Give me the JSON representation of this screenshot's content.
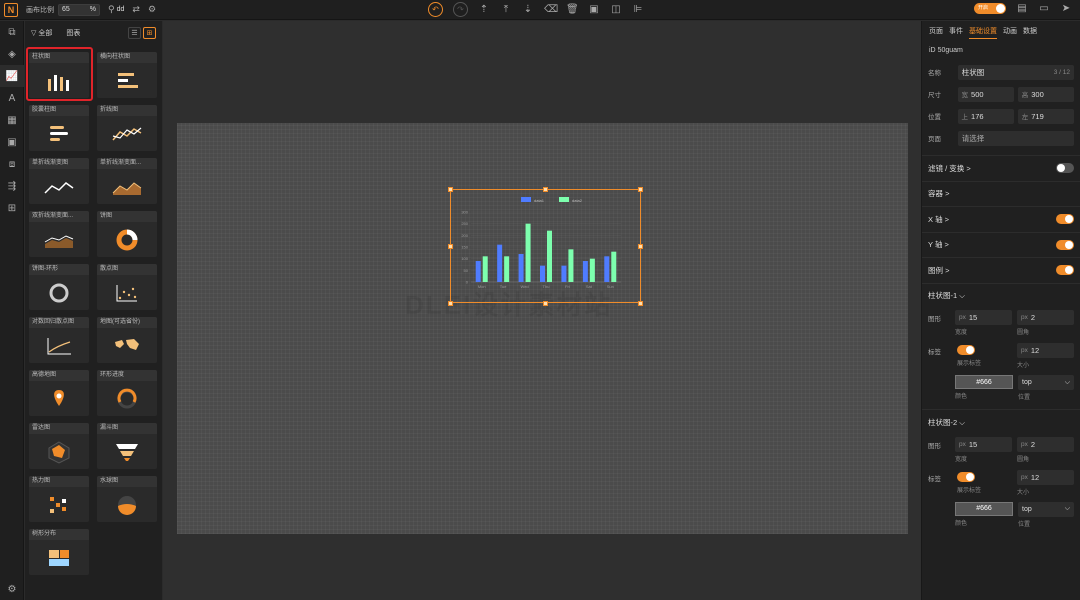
{
  "toolbar": {
    "zoom_label": "画布比例",
    "zoom_value": "65",
    "zoom_unit": "%",
    "user_text": "dd",
    "toggle_text": "开启"
  },
  "left_panel": {
    "filter_label": "全部",
    "title": "图表",
    "items": [
      {
        "label": "柱状图"
      },
      {
        "label": "横向柱状图"
      },
      {
        "label": "胶囊柱图"
      },
      {
        "label": "折线图"
      },
      {
        "label": "单折线渐变图"
      },
      {
        "label": "单折线渐变面..."
      },
      {
        "label": "双折线渐变面..."
      },
      {
        "label": "饼图"
      },
      {
        "label": "饼图-环形"
      },
      {
        "label": "散点图"
      },
      {
        "label": "对数回归散点图"
      },
      {
        "label": "地图(可选省份)"
      },
      {
        "label": "高德地图"
      },
      {
        "label": "环形进度"
      },
      {
        "label": "雷达图"
      },
      {
        "label": "漏斗图"
      },
      {
        "label": "热力图"
      },
      {
        "label": "水球图"
      },
      {
        "label": "树形分布"
      }
    ]
  },
  "mini_chart": {
    "legend": [
      "data1",
      "data2"
    ],
    "categories": [
      "Mon",
      "Tue",
      "Wed",
      "Thu",
      "Fri",
      "Sat",
      "Sun"
    ],
    "series1": [
      90,
      160,
      120,
      70,
      70,
      90,
      110
    ],
    "series2": [
      110,
      110,
      250,
      220,
      140,
      100,
      130
    ],
    "yticks": [
      "300",
      "250",
      "200",
      "150",
      "100",
      "50",
      "0"
    ],
    "colors": [
      "#4f7cff",
      "#7dffae"
    ]
  },
  "canvas": {
    "watermark": "DLEI设计素材站"
  },
  "right_panel": {
    "tabs": [
      "页面",
      "事件",
      "基础设置",
      "动画",
      "数据"
    ],
    "id_label": "iD",
    "id_value": "50guam",
    "name_label": "名称",
    "name_value": "柱状图",
    "name_count": "3 / 12",
    "size_label": "尺寸",
    "width_prefix": "宽",
    "width_value": "500",
    "height_prefix": "高",
    "height_value": "300",
    "pos_label": "位置",
    "top_prefix": "上",
    "top_value": "176",
    "left_prefix": "左",
    "left_value": "719",
    "page_label": "页面",
    "page_placeholder": "请选择",
    "sections": [
      "滤镜 / 变换 >",
      "容器 >",
      "X 轴 >",
      "Y 轴 >",
      "图例 >"
    ],
    "bar1_title": "柱状图-1",
    "bar2_title": "柱状图-2",
    "shape_label": "图形",
    "label_label": "标签",
    "bar_width": "15",
    "bar_radius": "2",
    "px": "px",
    "width_caption": "宽度",
    "radius_caption": "圆角",
    "show_label_caption": "展示标签",
    "size_caption": "大小",
    "font_size": "12",
    "color_value": "#666",
    "color_caption": "颜色",
    "position_value": "top",
    "position_caption": "位置"
  }
}
